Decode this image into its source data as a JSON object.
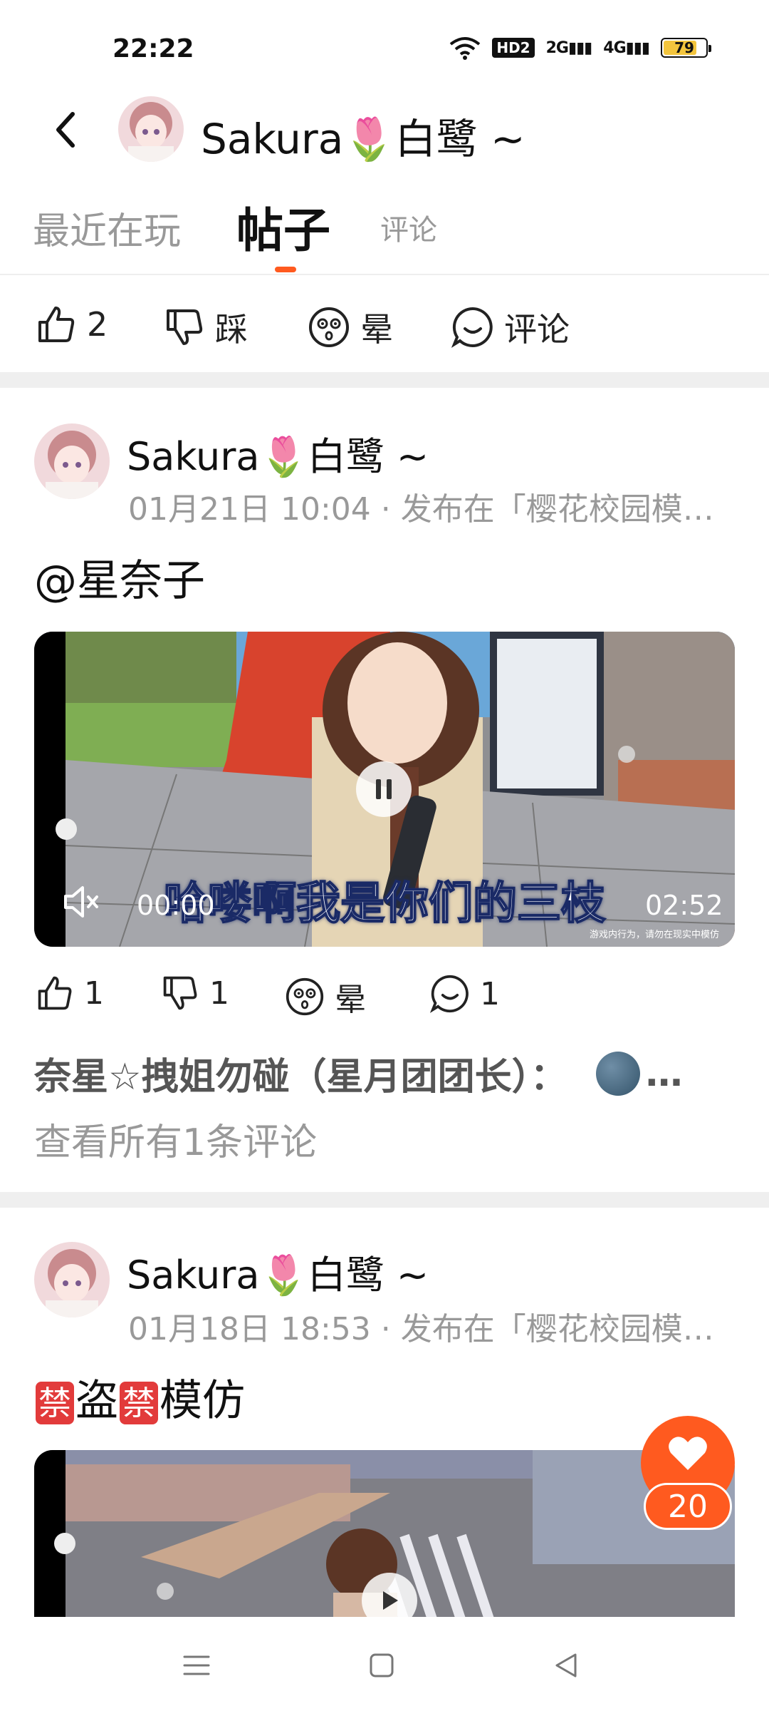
{
  "status": {
    "time": "22:22",
    "hd": "HD2",
    "sig1": "2G",
    "sig2": "4G",
    "battery": "79"
  },
  "header": {
    "name": "Sakura🌷白鹭 ~"
  },
  "tabs": {
    "recent": "最近在玩",
    "posts": "帖子",
    "comments": "评论"
  },
  "profile_actions": {
    "like_count": "2",
    "dislike_label": "踩",
    "dizzy_label": "晕",
    "comment_label": "评论"
  },
  "posts": [
    {
      "author": "Sakura🌷白鹭 ~",
      "meta": "01月21日 10:04 · 发布在「樱花校园模…",
      "text": "@星奈子",
      "video": {
        "subtitle": "哈喽啊我是你们的三枝",
        "current_time": "00:00",
        "duration": "02:52",
        "watermark": "游戏内行为，请勿在现实中模仿"
      },
      "actions": {
        "likes": "1",
        "dislikes": "1",
        "dizzy_label": "晕",
        "comments": "1"
      },
      "comment_preview": {
        "user": "奈星☆拽姐勿碰（星月团团长）：",
        "tail": "…"
      },
      "view_all": "查看所有1条评论"
    },
    {
      "author": "Sakura🌷白鹭 ~",
      "meta": "01月18日 18:53 · 发布在「樱花校园模…",
      "text_parts": {
        "badge": "禁",
        "word1": "盗",
        "word2": "模仿"
      }
    }
  ],
  "fab": {
    "like_count": "20"
  },
  "colors": {
    "accent": "#ff5a1f",
    "muted": "#999999",
    "divider": "#efefef"
  }
}
